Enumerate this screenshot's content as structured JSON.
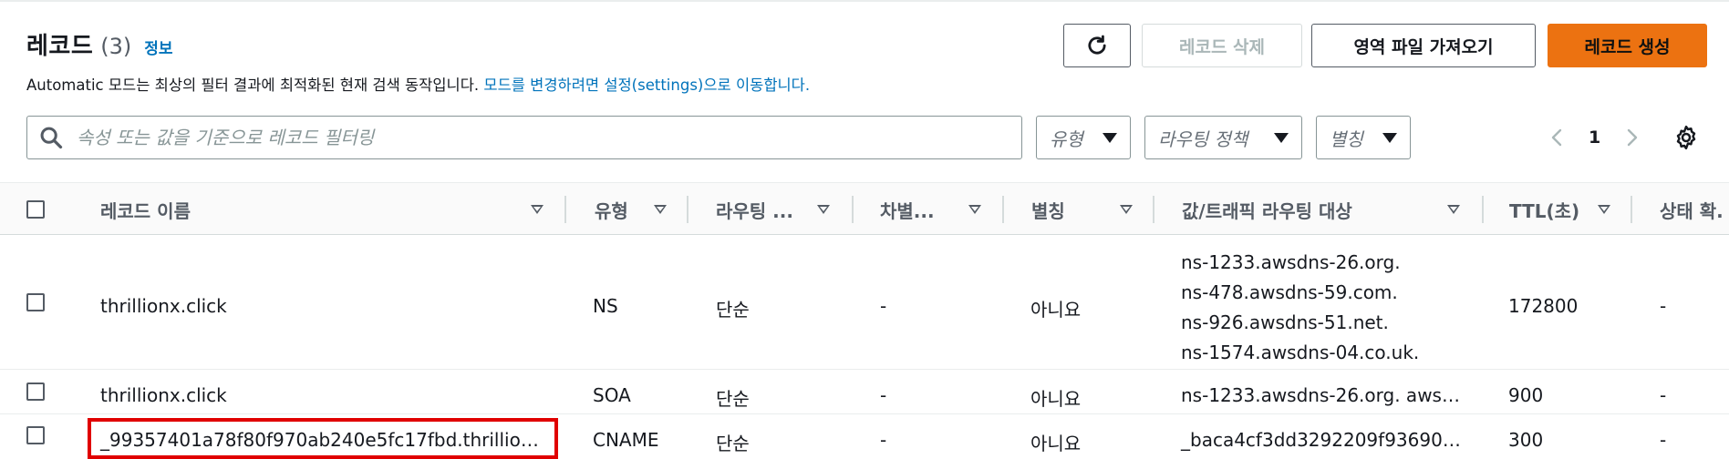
{
  "header": {
    "title": "레코드",
    "count": "(3)",
    "info_link": "정보",
    "description_prefix": "Automatic 모드는 최상의 필터 결과에 최적화된 현재 검색 동작입니다. ",
    "description_link": "모드를 변경하려면 설정(settings)으로 이동합니다."
  },
  "toolbar": {
    "refresh_icon": "refresh-icon",
    "delete_label": "레코드 삭제",
    "import_label": "영역 파일 가져오기",
    "create_label": "레코드 생성"
  },
  "filters": {
    "search_placeholder": "속성 또는 값을 기준으로 레코드 필터링",
    "type_placeholder": "유형",
    "routing_placeholder": "라우팅 정책",
    "alias_placeholder": "별칭"
  },
  "pagination": {
    "current_page": "1"
  },
  "table": {
    "columns": [
      "레코드 이름",
      "유형",
      "라우팅 ...",
      "차별...",
      "별칭",
      "값/트래픽 라우팅 대상",
      "TTL(초)",
      "상태 확."
    ],
    "rows": [
      {
        "name": "thrillionx.click",
        "type": "NS",
        "routing": "단순",
        "differentiator": "-",
        "alias": "아니요",
        "values": [
          "ns-1233.awsdns-26.org.",
          "ns-478.awsdns-59.com.",
          "ns-926.awsdns-51.net.",
          "ns-1574.awsdns-04.co.uk."
        ],
        "ttl": "172800",
        "health": "-"
      },
      {
        "name": "thrillionx.click",
        "type": "SOA",
        "routing": "단순",
        "differentiator": "-",
        "alias": "아니요",
        "values": [
          "ns-1233.awsdns-26.org. aws…"
        ],
        "ttl": "900",
        "health": "-"
      },
      {
        "name": "_99357401a78f80f970ab240e5fc17fbd.thrillio…",
        "type": "CNAME",
        "routing": "단순",
        "differentiator": "-",
        "alias": "아니요",
        "values": [
          "_baca4cf3dd3292209f93690…"
        ],
        "ttl": "300",
        "health": "-"
      }
    ]
  },
  "colors": {
    "primary": "#ec7211",
    "link": "#0073bb",
    "highlight": "#e00000"
  }
}
